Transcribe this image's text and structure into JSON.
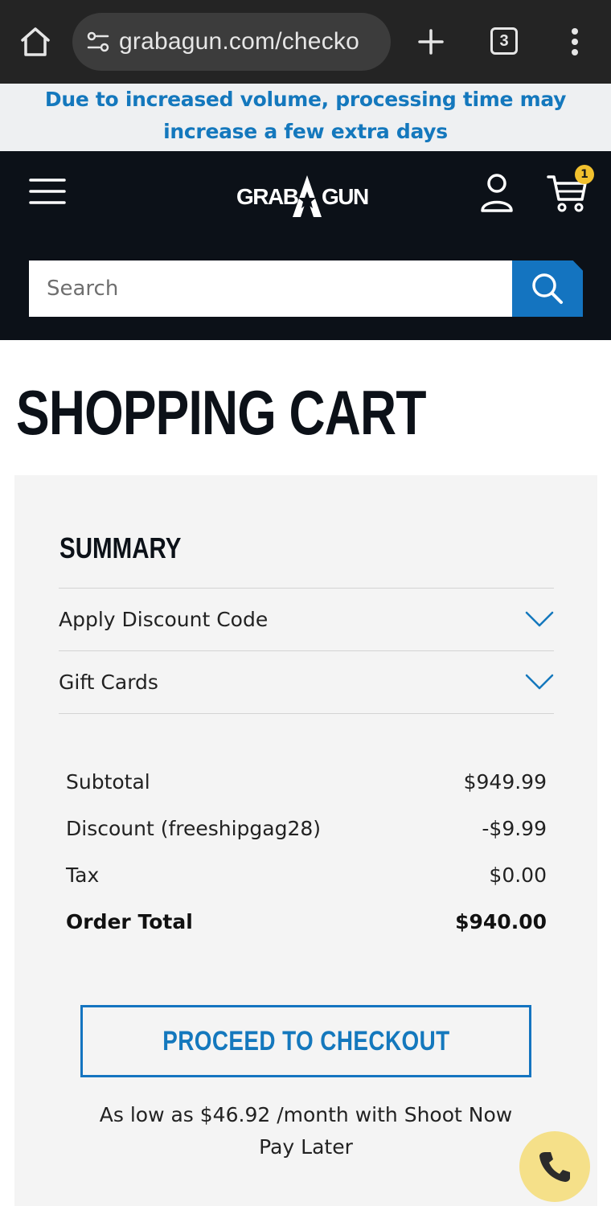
{
  "browser": {
    "url": "grabagun.com/checko",
    "tab_count": "3"
  },
  "announcement": {
    "text": "Due to increased volume, processing time may increase a few extra days"
  },
  "header": {
    "logo_text": "GRABAGUN",
    "cart_count": "1",
    "search_placeholder": "Search"
  },
  "page": {
    "title": "SHOPPING CART"
  },
  "summary": {
    "title": "SUMMARY",
    "accordions": [
      {
        "label": "Apply Discount Code"
      },
      {
        "label": "Gift Cards"
      }
    ],
    "rows": [
      {
        "label": "Subtotal",
        "value": "$949.99"
      },
      {
        "label": "Discount (freeshipgag28)",
        "value": "-$9.99"
      },
      {
        "label": "Tax",
        "value": "$0.00"
      },
      {
        "label": "Order Total",
        "value": "$940.00"
      }
    ],
    "checkout_label": "PROCEED TO CHECKOUT",
    "financing_text": "As low as $46.92 /month with Shoot Now Pay Later"
  },
  "colors": {
    "accent_blue": "#1478bd",
    "header_bg": "#0c1118",
    "badge_yellow": "#f2c12e",
    "phone_yellow": "#f5e089"
  },
  "icons": [
    "home-icon",
    "site-settings-icon",
    "new-tab-icon",
    "tab-switcher-icon",
    "more-options-icon",
    "hamburger-menu-icon",
    "account-icon",
    "cart-icon",
    "search-icon",
    "chevron-down-icon",
    "phone-icon"
  ]
}
